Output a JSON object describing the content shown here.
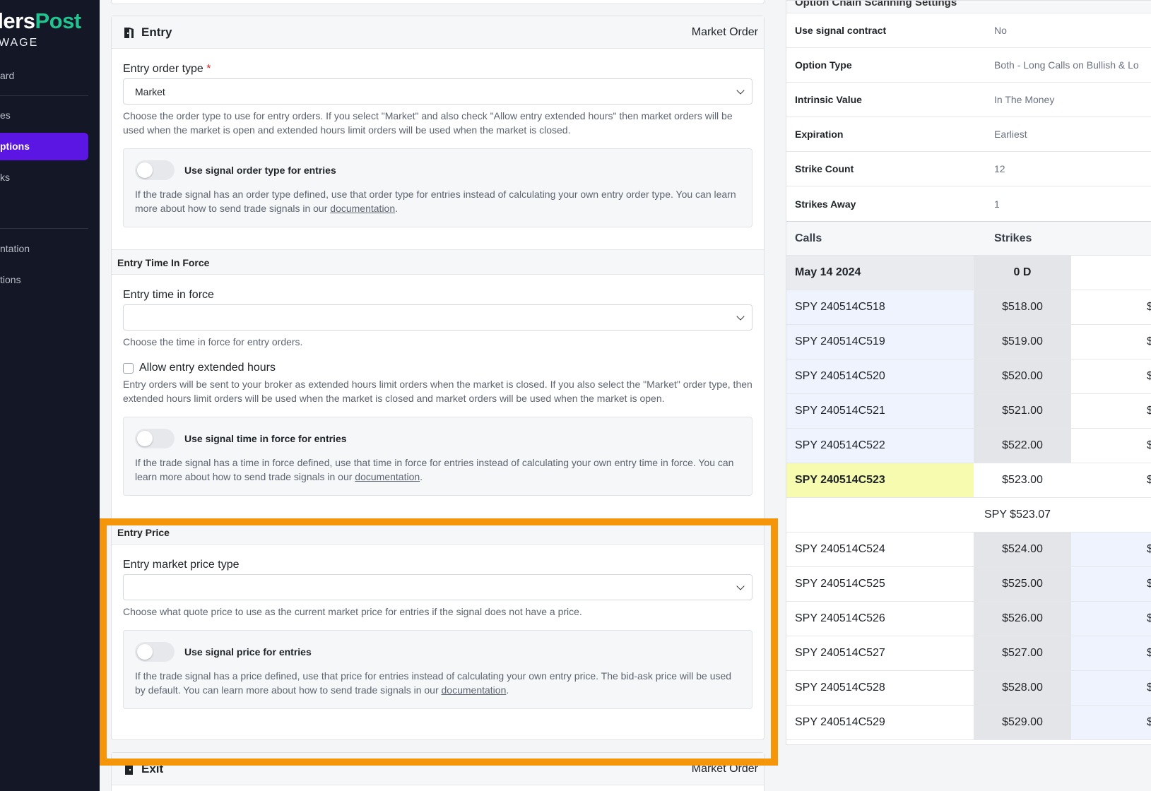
{
  "sidebar": {
    "brand_part1": "dersPost",
    "brand_part2": "Post",
    "brand_main": "ders",
    "brand_sub": "WAGE",
    "items": [
      {
        "label": "ard"
      },
      {
        "label": "es"
      },
      {
        "label": "ptions"
      },
      {
        "label": "ks"
      },
      {
        "label": "ntation"
      },
      {
        "label": "tions"
      }
    ]
  },
  "entry": {
    "title": "Entry",
    "summary": "Market Order",
    "order_type_label": "Entry order type",
    "required_mark": "*",
    "order_type_value": "Market",
    "order_type_help": "Choose the order type to use for entry orders. If you select \"Market\" and also check \"Allow entry extended hours\" then market orders will be used when the market is open and extended hours limit orders will be used when the market is closed.",
    "signal_order_toggle_label": "Use signal order type for entries",
    "signal_order_help_pre": "If the trade signal has an order type defined, use that order type for entries instead of calculating your own entry order type. You can learn more about how to send trade signals in our ",
    "doc_link": "documentation",
    "period": "."
  },
  "time_in_force": {
    "section_title": "Entry Time In Force",
    "label": "Entry time in force",
    "value": "",
    "help": "Choose the time in force for entry orders.",
    "extended_hours_label": "Allow entry extended hours",
    "extended_hours_help": "Entry orders will be sent to your broker as extended hours limit orders when the market is closed. If you also select the \"Market\" order type, then extended hours limit orders will be used when the market is closed and market orders will be used when the market is open.",
    "signal_tif_toggle_label": "Use signal time in force for entries",
    "signal_tif_help_pre": "If the trade signal has a time in force defined, use that time in force for entries instead of calculating your own entry time in force. You can learn more about how to send trade signals in our "
  },
  "entry_price": {
    "section_title": "Entry Price",
    "label": "Entry market price type",
    "value": "",
    "help": "Choose what quote price to use as the current market price for entries if the signal does not have a price.",
    "signal_price_toggle_label": "Use signal price for entries",
    "signal_price_help_pre": "If the trade signal has a price defined, use that price for entries instead of calculating your own entry price. The bid-ask price will be used by default. You can learn more about how to send trade signals in our "
  },
  "exit": {
    "title": "Exit",
    "summary": "Market Order"
  },
  "right_panel": {
    "title": "Option Chain Scanning Settings",
    "settings": [
      {
        "key": "Use signal contract",
        "value": "No"
      },
      {
        "key": "Option Type",
        "value": "Both - Long Calls on Bullish & Lo"
      },
      {
        "key": "Intrinsic Value",
        "value": "In The Money"
      },
      {
        "key": "Expiration",
        "value": "Earliest"
      },
      {
        "key": "Strike Count",
        "value": "12"
      },
      {
        "key": "Strikes Away",
        "value": "1"
      }
    ],
    "chain_headers": {
      "calls": "Calls",
      "strikes": "Strikes"
    },
    "expiry": {
      "date": "May 14 2024",
      "dte": "0 D"
    },
    "rows_above": [
      {
        "symbol": "SPY 240514C518",
        "strike": "$518.00",
        "edge": "$"
      },
      {
        "symbol": "SPY 240514C519",
        "strike": "$519.00",
        "edge": "$"
      },
      {
        "symbol": "SPY 240514C520",
        "strike": "$520.00",
        "edge": "$"
      },
      {
        "symbol": "SPY 240514C521",
        "strike": "$521.00",
        "edge": "$"
      },
      {
        "symbol": "SPY 240514C522",
        "strike": "$522.00",
        "edge": "$"
      },
      {
        "symbol": "SPY 240514C523",
        "strike": "$523.00",
        "edge": "$"
      }
    ],
    "underlying_price": "SPY $523.07",
    "rows_below": [
      {
        "symbol": "SPY 240514C524",
        "strike": "$524.00",
        "edge": "$"
      },
      {
        "symbol": "SPY 240514C525",
        "strike": "$525.00",
        "edge": "$"
      },
      {
        "symbol": "SPY 240514C526",
        "strike": "$526.00",
        "edge": "$"
      },
      {
        "symbol": "SPY 240514C527",
        "strike": "$527.00",
        "edge": "$"
      },
      {
        "symbol": "SPY 240514C528",
        "strike": "$528.00",
        "edge": "$"
      },
      {
        "symbol": "SPY 240514C529",
        "strike": "$529.00",
        "edge": "$"
      }
    ]
  },
  "colors": {
    "sidebar_bg": "#141826",
    "active_nav": "#5c16e3",
    "brand_green": "#21c38f",
    "highlight": "#f5960a",
    "atm_row": "#f6fbb0"
  }
}
